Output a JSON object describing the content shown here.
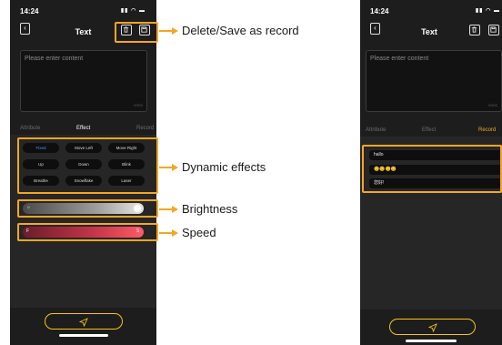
{
  "screen_left": {
    "status_time": "14:24",
    "title": "Text",
    "placeholder": "Please enter content",
    "counter": "0/500",
    "tabs": [
      "Attribute",
      "Effect",
      "Record"
    ],
    "active_tab": "Effect",
    "effects": [
      {
        "label": "Fixed",
        "selected": true
      },
      {
        "label": "Move Left",
        "selected": false
      },
      {
        "label": "Move Right",
        "selected": false
      },
      {
        "label": "Up",
        "selected": false
      },
      {
        "label": "Down",
        "selected": false
      },
      {
        "label": "Blink",
        "selected": false
      },
      {
        "label": "Breathe",
        "selected": false
      },
      {
        "label": "Snowflake",
        "selected": false
      },
      {
        "label": "Laser",
        "selected": false
      }
    ],
    "brightness_icon_left": "☼",
    "brightness_icon_right": "☀",
    "speed_icon_left": "F",
    "speed_icon_right": "S"
  },
  "screen_right": {
    "status_time": "14:24",
    "title": "Text",
    "placeholder": "Please enter content",
    "counter": "0/500",
    "tabs": [
      "Attribute",
      "Effect",
      "Record"
    ],
    "active_tab": "Record",
    "records": [
      "hallo",
      "😊😊😊😊",
      "您好!"
    ]
  },
  "callouts": {
    "delete_save": "Delete/Save as record",
    "dynamic_effects": "Dynamic effects",
    "brightness": "Brightness",
    "speed": "Speed"
  },
  "colors": {
    "highlight": "#f5a623",
    "selected_effect": "#3a9cff",
    "phone_bg": "#1d1d1d"
  }
}
